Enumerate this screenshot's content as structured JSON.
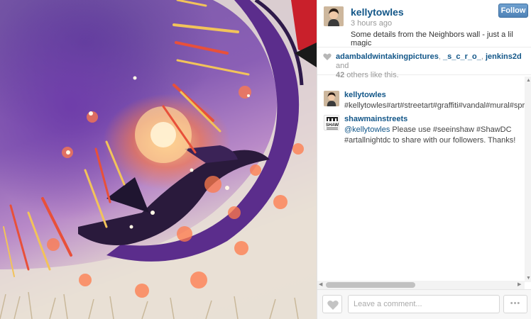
{
  "post": {
    "username": "kellytowles",
    "timestamp": "3 hours ago",
    "caption": "Some details from the Neighbors wall - just a lil magic",
    "follow_label": "Follow"
  },
  "likes": {
    "users": [
      "adambaldwintakingpictures",
      "_s_c_r_o_",
      "jenkins2d"
    ],
    "separator": ", ",
    "and_label": " and",
    "others_count": "42",
    "others_suffix": " others like this."
  },
  "comments": [
    {
      "username": "kellytowles",
      "text": "#kellytowles#art#streetart#graffiti#vandal#mural#spraypaint"
    },
    {
      "username": "shawmainstreets",
      "avatar_text": "SHAW",
      "mention": "@kellytowles",
      "text": " Please use #seeinshaw #ShawDC #artallnightdc to share with our followers. Thanks!"
    }
  ],
  "footer": {
    "comment_placeholder": "Leave a comment...",
    "more_label": "•••"
  },
  "icons": {
    "heart": "heart-icon",
    "more": "more-options-icon"
  },
  "colors": {
    "username_blue": "#125688",
    "follow_button": "#4f83b7"
  }
}
